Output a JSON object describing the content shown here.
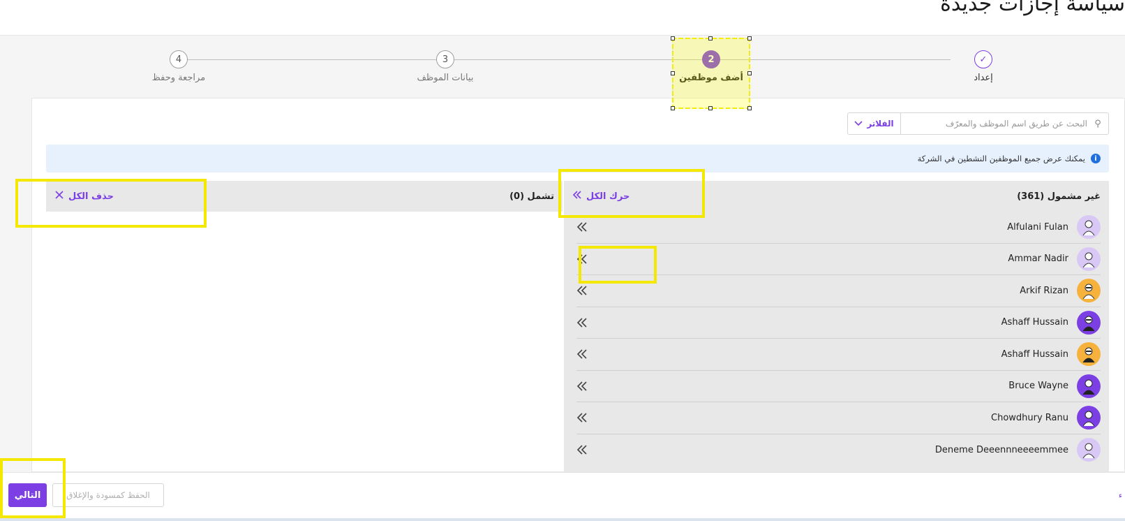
{
  "page": {
    "title": "سياسة إجازات جديدة"
  },
  "stepper": {
    "steps": [
      {
        "number": "✓",
        "label": "إعداد"
      },
      {
        "number": "2",
        "label": "أضف موظفين"
      },
      {
        "number": "3",
        "label": "بيانات الموظف"
      },
      {
        "number": "4",
        "label": "مراجعة وحفظ"
      }
    ]
  },
  "search": {
    "placeholder": "البحث عن طريق اسم الموظف والمعرّف",
    "filter_label": "الفلاتر"
  },
  "info": {
    "text": "يمكنك عرض جميع الموظفين النشطين في الشركة"
  },
  "excluded": {
    "title": "غير مشمول (361)",
    "move_all_label": "حرك الكل",
    "employees": [
      {
        "name": "Alfulani Fulan",
        "avatar_color": "#d9c8f5"
      },
      {
        "name": "Ammar Nadir",
        "avatar_color": "#d9c8f5"
      },
      {
        "name": "Arkif Rizan",
        "avatar_color": "#f6b23c"
      },
      {
        "name": "Ashaff Hussain",
        "avatar_color": "#7b3fe4"
      },
      {
        "name": "Ashaff Hussain",
        "avatar_color": "#f6b23c"
      },
      {
        "name": "Bruce Wayne",
        "avatar_color": "#7b3fe4"
      },
      {
        "name": "Chowdhury Ranu",
        "avatar_color": "#7b3fe4"
      },
      {
        "name": "Deneme Deeennneeeemmee",
        "avatar_color": "#d9c8f5"
      }
    ]
  },
  "included": {
    "title": "تشمل (0)",
    "remove_all_label": "حذف الكل"
  },
  "footer": {
    "next_label": "التالي",
    "save_draft_label": "الحفظ كمسودة والإغلاق",
    "edge_text": "ء"
  },
  "colors": {
    "accent": "#7b3fe4",
    "info_bg": "#e7f0fd",
    "highlight": "#f5e800"
  }
}
